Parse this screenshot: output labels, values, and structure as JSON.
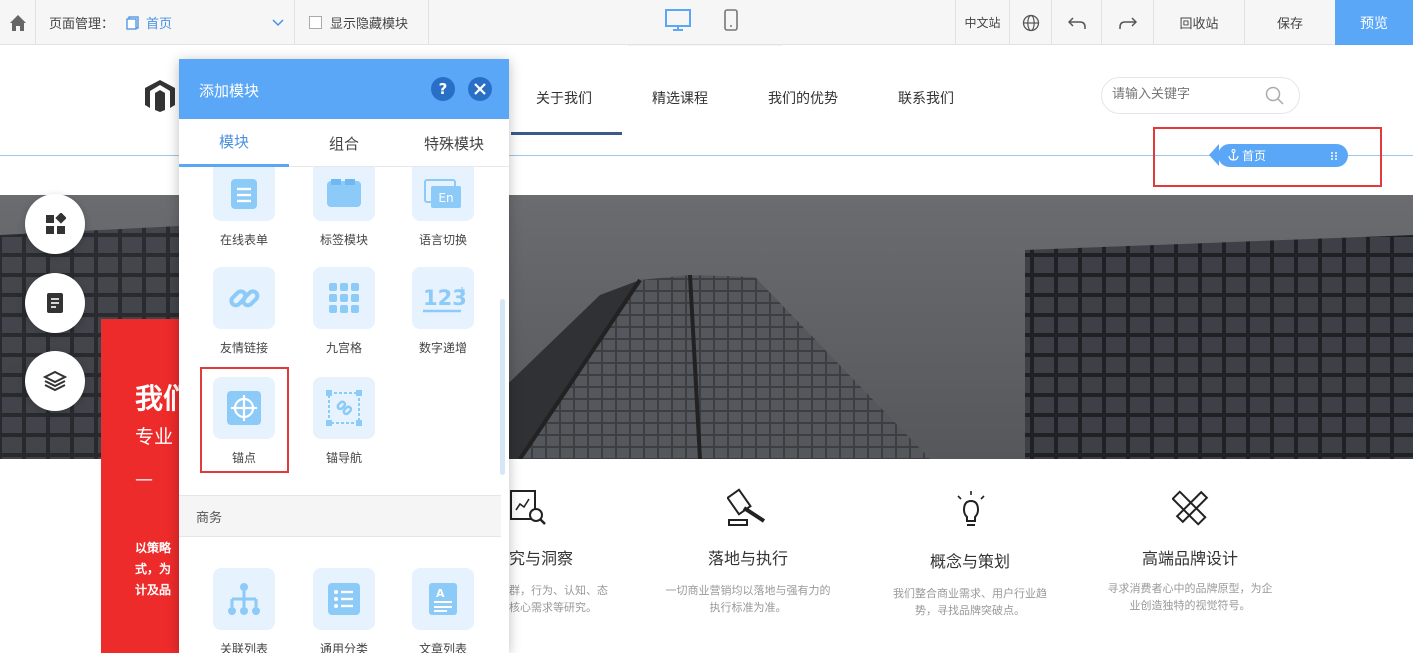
{
  "toolbar": {
    "page_mgmt_label": "页面管理：",
    "current_page": "首页",
    "show_hidden_label": "显示隐藏模块",
    "lang_label": "中文站",
    "recycle_label": "回收站",
    "save_label": "保存",
    "preview_label": "预览"
  },
  "site": {
    "nav": [
      "关于我们",
      "精选课程",
      "我们的优势",
      "联系我们"
    ],
    "search_placeholder": "请输入关键字",
    "anchor_tag": "首页"
  },
  "hero": {
    "title_partial": "我们",
    "subtitle_partial": "专业",
    "dash": "—",
    "body_partial": [
      "以策略",
      "式，为",
      "计及品"
    ]
  },
  "features": [
    {
      "title": "究与洞察",
      "desc": [
        "群，行为、认知、态",
        "核心需求等研究。"
      ]
    },
    {
      "title": "落地与执行",
      "desc": [
        "一切商业营销均以落地与强有力的",
        "执行标准为准。"
      ]
    },
    {
      "title": "概念与策划",
      "desc": [
        "我们整合商业需求、用户行业趋",
        "势，寻找品牌突破点。"
      ]
    },
    {
      "title": "高端品牌设计",
      "desc": [
        "寻求消费者心中的品牌原型，为企",
        "业创造独特的视觉符号。"
      ]
    }
  ],
  "panel": {
    "title": "添加模块",
    "tabs": [
      "模块",
      "组合",
      "特殊模块"
    ],
    "modules": [
      "在线表单",
      "标签模块",
      "语言切换",
      "友情链接",
      "九宫格",
      "数字递增",
      "锚点",
      "锚导航"
    ],
    "section_biz": "商务",
    "biz_modules": [
      "关联列表",
      "通用分类",
      "文章列表"
    ]
  },
  "colors": {
    "accent": "#5aa7f8",
    "red": "#ee2b2b",
    "highlight": "#e03a3a"
  }
}
